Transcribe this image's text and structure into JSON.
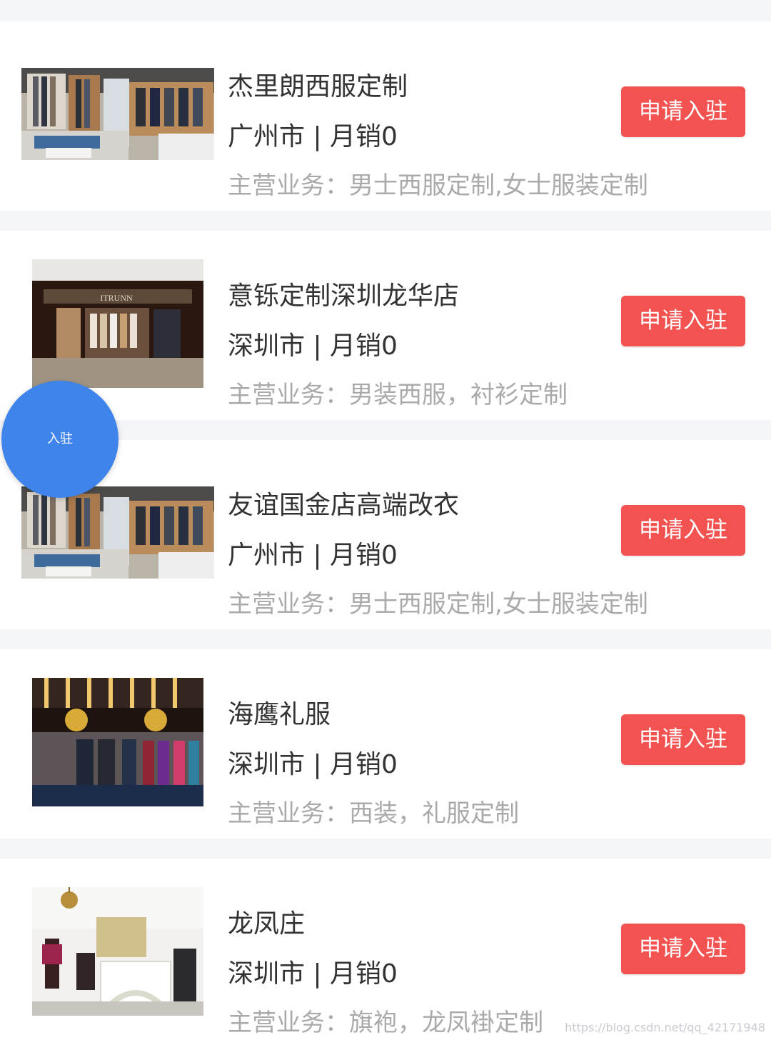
{
  "stores": [
    {
      "name": "杰里朗西服定制",
      "meta": "广州市 | 月销0",
      "business": "主营业务：男士西服定制,女士服装定制",
      "button": "申请入驻",
      "image": "suit-showroom-icon"
    },
    {
      "name": "意铄定制深圳龙华店",
      "meta": "深圳市 | 月销0",
      "business": "主营业务：男装西服，衬衫定制",
      "button": "申请入驻",
      "image": "mall-store-front-icon"
    },
    {
      "name": "友谊国金店高端改衣",
      "meta": "广州市 | 月销0",
      "business": "主营业务：男士西服定制,女士服装定制",
      "button": "申请入驻",
      "image": "suit-showroom-icon"
    },
    {
      "name": "海鹰礼服",
      "meta": "深圳市 | 月销0",
      "business": "主营业务：西装，礼服定制",
      "button": "申请入驻",
      "image": "formal-wear-shop-icon"
    },
    {
      "name": "龙凤庄",
      "meta": "深圳市 | 月销0",
      "business": "主营业务：旗袍，龙凤褂定制",
      "button": "申请入驻",
      "image": "bridal-shop-interior-icon"
    }
  ],
  "floating_action": {
    "label": "入驻",
    "color": "#3f84ea"
  },
  "watermark": "https://blog.csdn.net/qq_42171948",
  "colors": {
    "accent": "#f35350",
    "background": "#f4f5f9",
    "card": "#ffffff",
    "secondary_text": "#aaaaaa"
  }
}
